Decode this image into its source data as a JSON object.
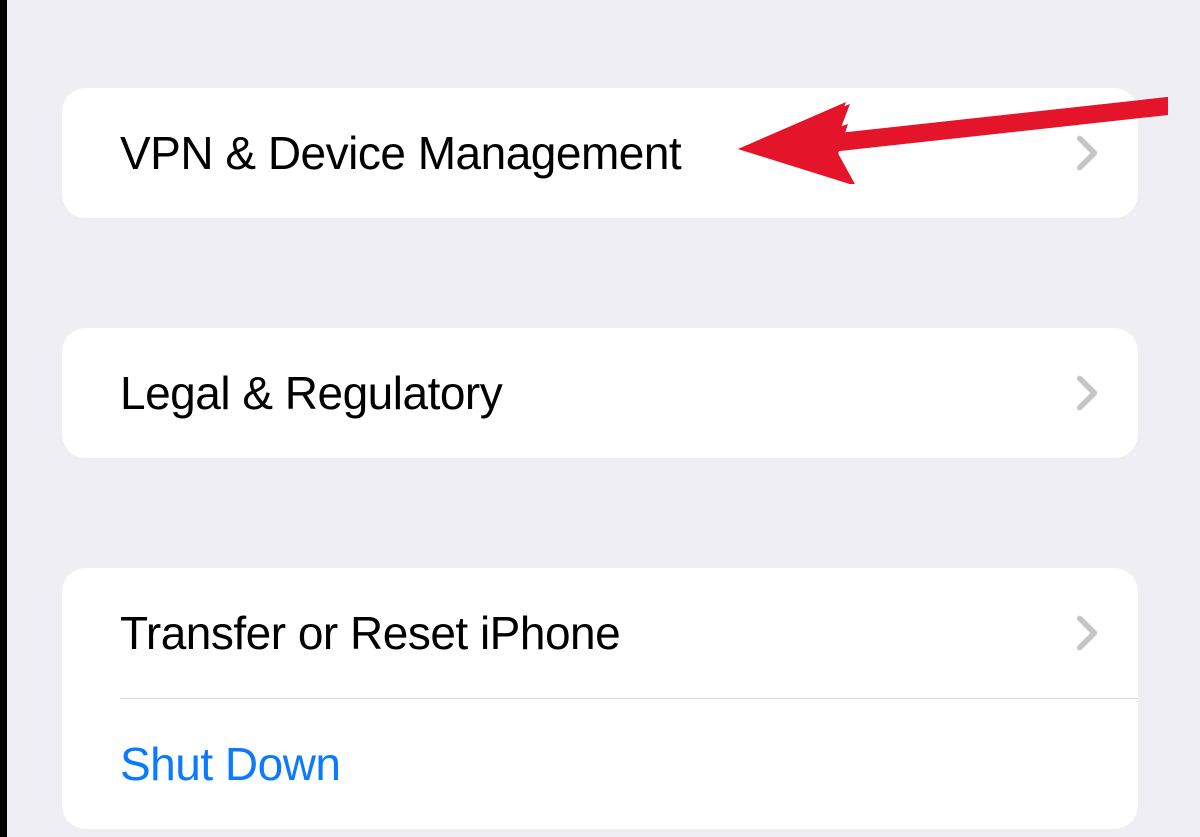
{
  "groups": [
    {
      "name": "vpn-group",
      "rows": [
        {
          "name": "vpn-device-management",
          "label": "VPN & Device Management",
          "chevron": true,
          "link": false
        }
      ]
    },
    {
      "name": "legal-group",
      "rows": [
        {
          "name": "legal-regulatory",
          "label": "Legal & Regulatory",
          "chevron": true,
          "link": false
        }
      ]
    },
    {
      "name": "reset-group",
      "rows": [
        {
          "name": "transfer-reset",
          "label": "Transfer or Reset iPhone",
          "chevron": true,
          "link": false
        },
        {
          "name": "shut-down",
          "label": "Shut Down",
          "chevron": false,
          "link": true
        }
      ]
    }
  ],
  "annotation": {
    "type": "arrow",
    "color": "#e4142b",
    "target": "vpn-device-management"
  }
}
